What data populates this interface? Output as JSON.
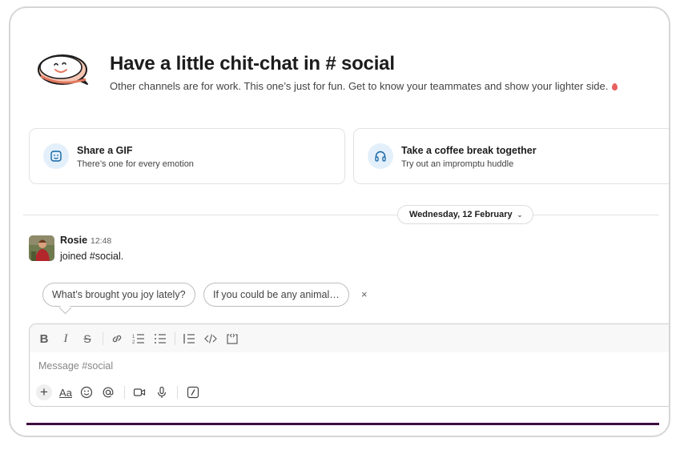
{
  "hero": {
    "title": "Have a little chit-chat in # social",
    "subtitle": "Other channels are for work. This one’s just for fun. Get to know your teammates and show your lighter side."
  },
  "cards": [
    {
      "title": "Share a GIF",
      "subtitle": "There’s one for every emotion",
      "icon": "gif-icon"
    },
    {
      "title": "Take a coffee break together",
      "subtitle": "Try out an impromptu huddle",
      "icon": "headphones-icon"
    }
  ],
  "date_divider": {
    "label": "Wednesday, 12 February",
    "icon": "chevron-down-icon"
  },
  "message": {
    "author": "Rosie",
    "time": "12:48",
    "text": "joined #social."
  },
  "prompts": [
    "What’s brought you joy lately?",
    "If you could be any animal…"
  ],
  "dismiss_label": "×",
  "composer": {
    "placeholder": "Message #social",
    "format_tools": [
      "bold-icon",
      "italic-icon",
      "strikethrough-icon",
      "link-icon",
      "ordered-list-icon",
      "bulleted-list-icon",
      "blockquote-icon",
      "code-icon",
      "code-block-icon"
    ],
    "action_tools": [
      "plus-icon",
      "formatting-icon",
      "emoji-icon",
      "mention-icon",
      "video-icon",
      "microphone-icon",
      "slash-command-icon"
    ]
  },
  "colors": {
    "accent": "#3f0e40",
    "card_icon_bg": "#e3f0fb",
    "card_icon": "#1264a3",
    "balloon": "#e8605f"
  }
}
